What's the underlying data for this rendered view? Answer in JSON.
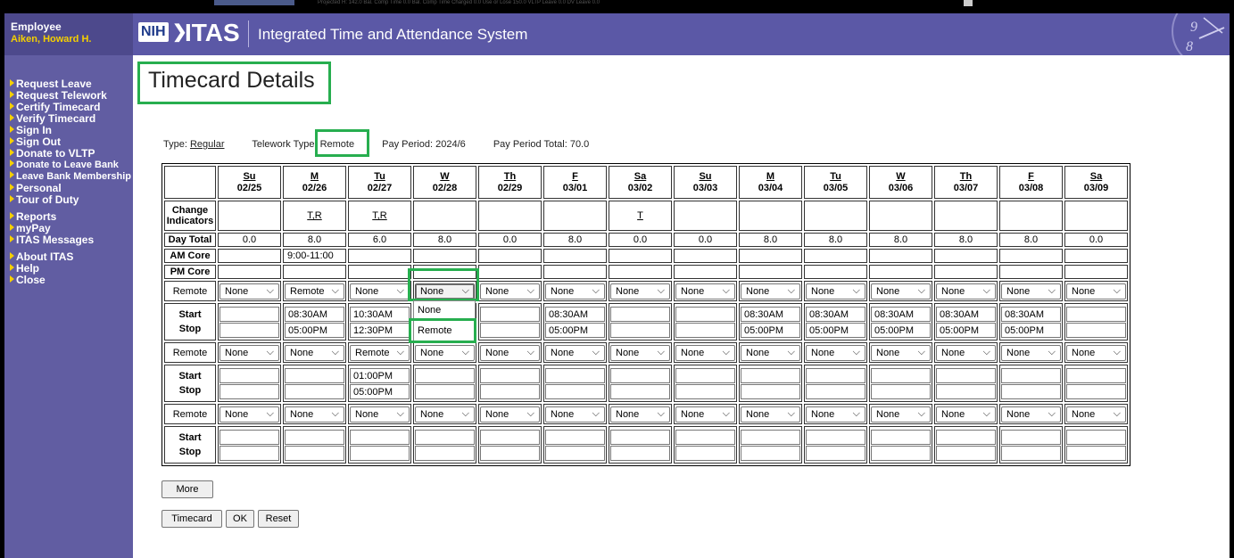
{
  "top_strip": {
    "ghost_text": "Projected H: 142.0    Bal. Comp Time 0.0    Bal. Comp Time Charged 0.0    Use or Lose 150.0          VLTP Leave 0.0          DV Leave 0.0"
  },
  "sidebar": {
    "employee_label": "Employee",
    "employee_name": "Aiken, Howard H.",
    "nav": [
      "Request Leave",
      "Request Telework",
      "Certify Timecard",
      "Verify Timecard",
      "Sign In",
      "Sign Out",
      "Donate to VLTP",
      "Donate to Leave Bank",
      "Leave Bank Membership",
      "Personal",
      "Tour of Duty",
      "Reports",
      "myPay",
      "ITAS Messages",
      "About ITAS",
      "Help",
      "Close"
    ]
  },
  "header": {
    "nih": "NIH",
    "arrow": "❯",
    "itas": "ITAS",
    "title": "Integrated Time and Attendance System"
  },
  "page": {
    "title": "Timecard Details",
    "type_label": "Type:",
    "type_value": "Regular",
    "telework_type": "Telework Type: Remote",
    "pay_period": "Pay Period: 2024/6",
    "pay_period_total": "Pay Period Total: 70.0"
  },
  "grid": {
    "days": [
      {
        "d": "Su",
        "date": "02/25"
      },
      {
        "d": "M",
        "date": "02/26"
      },
      {
        "d": "Tu",
        "date": "02/27"
      },
      {
        "d": "W",
        "date": "02/28"
      },
      {
        "d": "Th",
        "date": "02/29"
      },
      {
        "d": "F",
        "date": "03/01"
      },
      {
        "d": "Sa",
        "date": "03/02"
      },
      {
        "d": "Su",
        "date": "03/03"
      },
      {
        "d": "M",
        "date": "03/04"
      },
      {
        "d": "Tu",
        "date": "03/05"
      },
      {
        "d": "W",
        "date": "03/06"
      },
      {
        "d": "Th",
        "date": "03/07"
      },
      {
        "d": "F",
        "date": "03/08"
      },
      {
        "d": "Sa",
        "date": "03/09"
      }
    ],
    "labels": {
      "change_indicators": "Change Indicators",
      "day_total": "Day Total",
      "am_core": "AM Core",
      "pm_core": "PM Core",
      "remote": "Remote",
      "start": "Start",
      "stop": "Stop"
    },
    "change_indicators": [
      "",
      "T,R",
      "T,R",
      "",
      "",
      "",
      "T",
      "",
      "",
      "",
      "",
      "",
      "",
      ""
    ],
    "day_totals": [
      "0.0",
      "8.0",
      "6.0",
      "8.0",
      "0.0",
      "8.0",
      "0.0",
      "0.0",
      "8.0",
      "8.0",
      "8.0",
      "8.0",
      "8.0",
      "0.0"
    ],
    "am_core": [
      "",
      "9:00-11:00",
      "",
      "",
      "",
      "",
      "",
      "",
      "",
      "",
      "",
      "",
      "",
      ""
    ],
    "blocks": [
      {
        "remote": [
          "None",
          "Remote",
          "None",
          "None",
          "None",
          "None",
          "None",
          "None",
          "None",
          "None",
          "None",
          "None",
          "None",
          "None"
        ],
        "start": [
          "",
          "08:30AM",
          "10:30AM",
          "",
          "",
          "08:30AM",
          "",
          "",
          "08:30AM",
          "08:30AM",
          "08:30AM",
          "08:30AM",
          "08:30AM",
          ""
        ],
        "stop": [
          "",
          "05:00PM",
          "12:30PM",
          "",
          "",
          "05:00PM",
          "",
          "",
          "05:00PM",
          "05:00PM",
          "05:00PM",
          "05:00PM",
          "05:00PM",
          ""
        ]
      },
      {
        "remote": [
          "None",
          "None",
          "Remote",
          "None",
          "None",
          "None",
          "None",
          "None",
          "None",
          "None",
          "None",
          "None",
          "None",
          "None"
        ],
        "start": [
          "",
          "",
          "01:00PM",
          "",
          "",
          "",
          "",
          "",
          "",
          "",
          "",
          "",
          "",
          ""
        ],
        "stop": [
          "",
          "",
          "05:00PM",
          "",
          "",
          "",
          "",
          "",
          "",
          "",
          "",
          "",
          "",
          ""
        ]
      },
      {
        "remote": [
          "None",
          "None",
          "None",
          "None",
          "None",
          "None",
          "None",
          "None",
          "None",
          "None",
          "None",
          "None",
          "None",
          "None"
        ],
        "start": [
          "",
          "",
          "",
          "",
          "",
          "",
          "",
          "",
          "",
          "",
          "",
          "",
          "",
          ""
        ],
        "stop": [
          "",
          "",
          "",
          "",
          "",
          "",
          "",
          "",
          "",
          "",
          "",
          "",
          "",
          ""
        ]
      }
    ]
  },
  "dropdown": {
    "options": [
      "None",
      "Remote"
    ],
    "covered_text": "None"
  },
  "buttons": {
    "more": "More",
    "timecard": "Timecard",
    "ok": "OK",
    "reset": "Reset"
  },
  "colors": {
    "sidebar": "#615da2",
    "header": "#5b58a6",
    "accent_yellow": "#f5d000",
    "highlight_green": "#27ae4f"
  }
}
